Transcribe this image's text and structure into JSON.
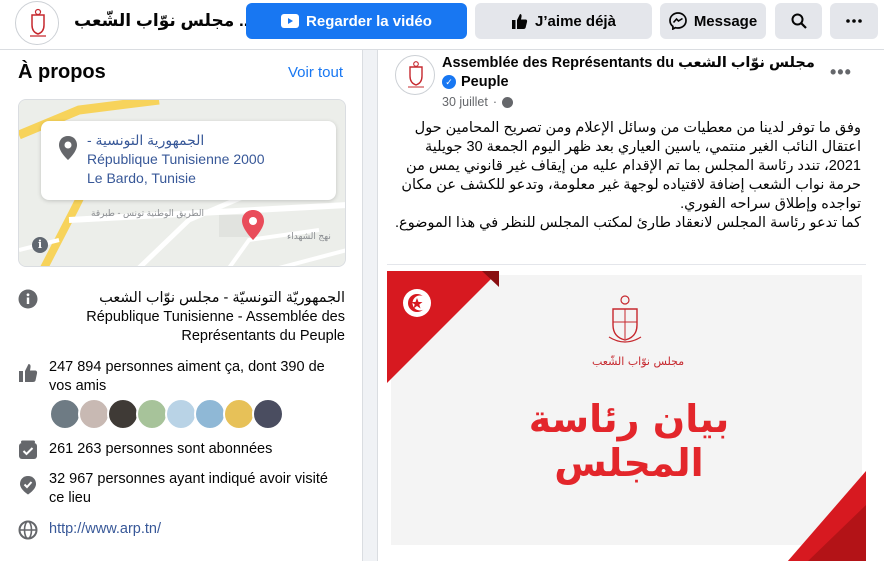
{
  "header": {
    "page_name": "مجلس نوّاب الشّعب ...",
    "watch_video_label": "Regarder la vidéo",
    "like_label": "J’aime déjà",
    "message_label": "Message"
  },
  "about": {
    "title": "À propos",
    "see_all": "Voir tout",
    "map": {
      "line1": "الجمهورية التونسية -",
      "line2": "République Tunisienne 2000",
      "line3": "Le Bardo, Tunisie",
      "street1": "الطريق الوطنية تونس - طبرقة",
      "street2": "نهج الشهداء"
    },
    "category": "الجمهوريّة التونسيّة - مجلس نوّاب الشعب République Tunisienne - Assemblée des Représentants du Peuple",
    "likes": "247 894 personnes aiment ça, dont 390 de vos amis",
    "followers": "261 263 personnes sont abonnées",
    "checkins": "32 967 personnes ayant indiqué avoir visité ce lieu",
    "website": "http://www.arp.tn/"
  },
  "post": {
    "author_line1": "Assemblée des Représentants du مجلس نوّاب الشعب",
    "author_line2": "Peuple",
    "date": "30 juillet",
    "text_p1": "وفق ما توفر لدينا من معطيات من وسائل الإعلام ومن تصريح المحامين حول اعتقال النائب الغير منتمي، ياسين العياري بعد ظهر اليوم الجمعة 30 جويلية 2021، تندد رئاسة المجلس بما تم الإقدام عليه من إيقاف غير قانوني يمس من حرمة نواب الشعب إضافة لاقتياده لوجهة غير معلومة، وتدعو للكشف عن مكان تواجده وإطلاق سراحه الفوري.",
    "text_p2": "كما تدعو رئاسة المجلس لانعقاد طارئ لمكتب المجلس للنظر في هذا الموضوع.",
    "image_title": "بيان رئاسة المجلس",
    "emblem_caption": "مجلس نوّاب الشّعب"
  },
  "colors": {
    "primary": "#1877f2",
    "link": "#385898",
    "banner_red": "#e3262b"
  },
  "icons": [
    "youtube-icon",
    "thumbs-up-icon",
    "messenger-icon",
    "search-icon",
    "more-icon",
    "info-icon",
    "location-pin-icon",
    "followers-icon",
    "checkin-icon",
    "globe-icon",
    "verified-icon"
  ]
}
